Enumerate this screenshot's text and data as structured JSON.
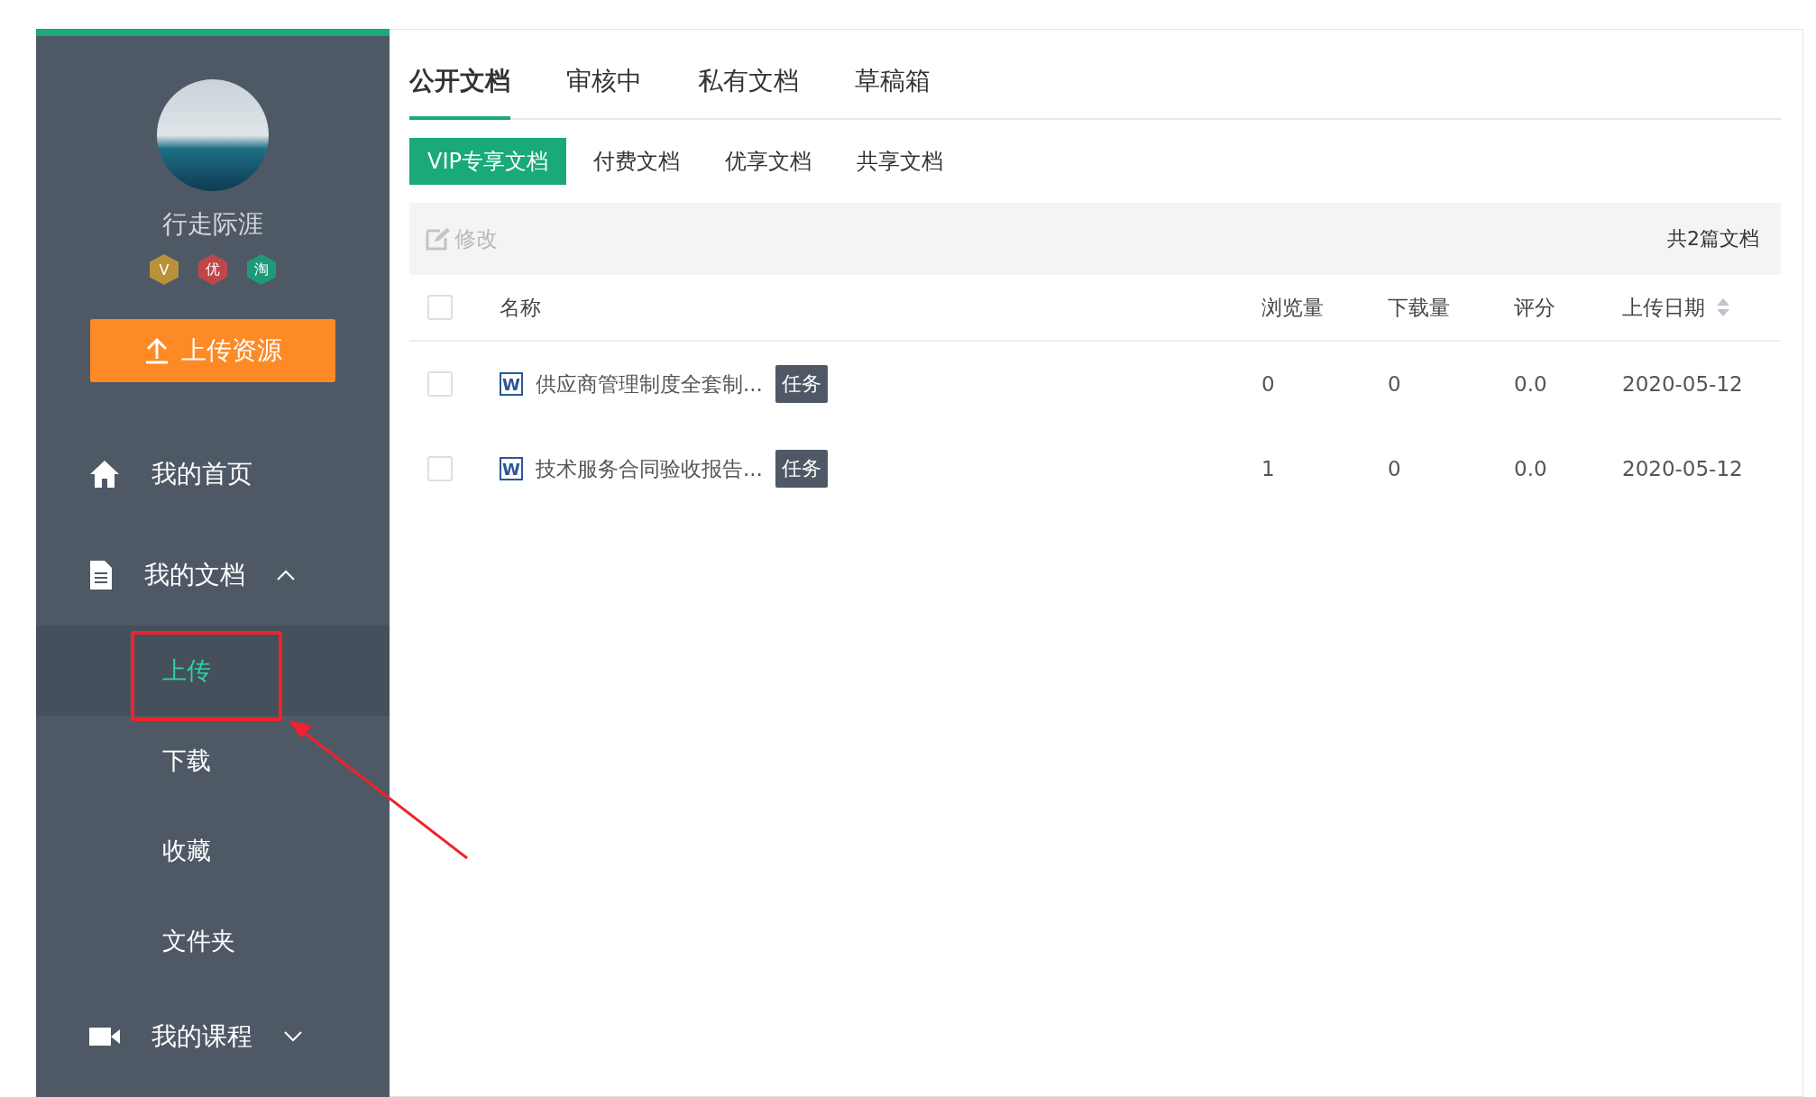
{
  "sidebar": {
    "user": {
      "name": "行走际涯",
      "badges": [
        {
          "label": "V",
          "color": "#b8913a"
        },
        {
          "label": "优",
          "color": "#c0464a"
        },
        {
          "label": "淘",
          "color": "#1f9a78"
        }
      ]
    },
    "upload_button": "上传资源",
    "menu": [
      {
        "label": "我的首页",
        "kind": "home"
      },
      {
        "label": "我的文档",
        "kind": "document",
        "expanded": true,
        "children": [
          {
            "label": "上传",
            "selected": true
          },
          {
            "label": "下载",
            "selected": false
          },
          {
            "label": "收藏",
            "selected": false
          },
          {
            "label": "文件夹",
            "selected": false
          }
        ]
      },
      {
        "label": "我的课程",
        "kind": "video",
        "expanded": false
      }
    ]
  },
  "tabs": [
    {
      "label": "公开文档",
      "selected": true
    },
    {
      "label": "审核中",
      "selected": false
    },
    {
      "label": "私有文档",
      "selected": false
    },
    {
      "label": "草稿箱",
      "selected": false
    }
  ],
  "subtabs": [
    {
      "label": "VIP专享文档",
      "selected": true
    },
    {
      "label": "付费文档",
      "selected": false
    },
    {
      "label": "优享文档",
      "selected": false
    },
    {
      "label": "共享文档",
      "selected": false
    }
  ],
  "toolbar": {
    "edit": "修改",
    "count": "共2篇文档"
  },
  "table": {
    "all_checked": false,
    "columns": [
      "名称",
      "浏览量",
      "下载量",
      "评分",
      "上传日期"
    ],
    "rows": [
      {
        "checked": false,
        "icon_letter": "W",
        "name": "供应商管理制度全套制...",
        "tag": "任务",
        "views": "0",
        "downloads": "0",
        "rating": "0.0",
        "date": "2020-05-12"
      },
      {
        "checked": false,
        "icon_letter": "W",
        "name": "技术服务合同验收报告...",
        "tag": "任务",
        "views": "1",
        "downloads": "0",
        "rating": "0.0",
        "date": "2020-05-12"
      }
    ]
  }
}
